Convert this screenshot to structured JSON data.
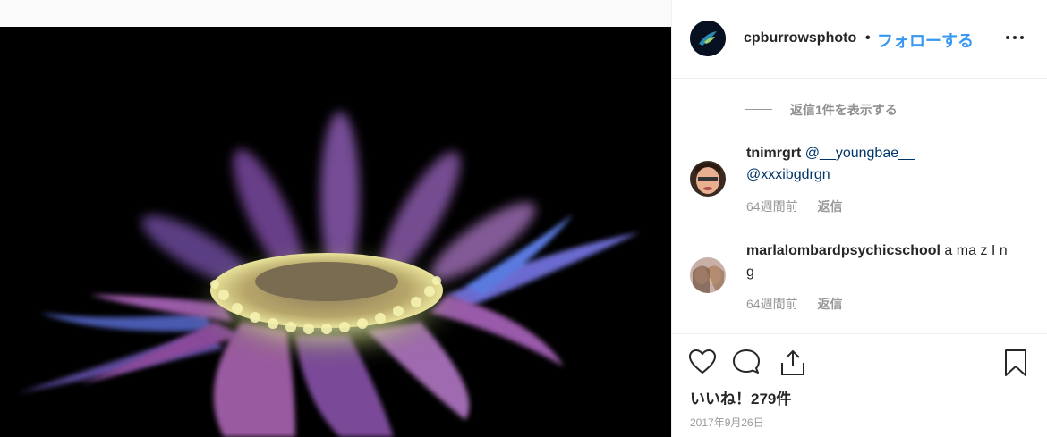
{
  "post": {
    "username": "cpburrowsphoto",
    "separator": "•",
    "follow_label": "フォローする"
  },
  "comments_section": {
    "view_replies": "返信1件を表示する",
    "comments": [
      {
        "user": "tnimrgrt",
        "mention_1": "@__youngbae__",
        "mention_2": "@xxxibgdrgn",
        "age": "64週間前",
        "reply_label": "返信"
      },
      {
        "user": "marlalombardpsychicschool",
        "text": "a ma z I n g",
        "age": "64週間前",
        "reply_label": "返信"
      }
    ]
  },
  "actions": {
    "likes": "いいね！279件",
    "date": "2017年9月26日",
    "icons": [
      "heart-icon",
      "comment-icon",
      "share-icon",
      "bookmark-icon"
    ]
  },
  "colors": {
    "accent": "#3897f0",
    "mention": "#003569",
    "muted": "#999999",
    "photo_bg": "#000000"
  }
}
